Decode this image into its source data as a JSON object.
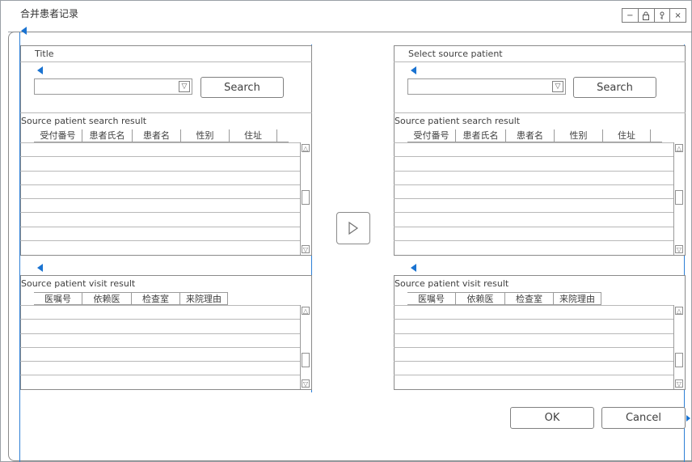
{
  "window": {
    "title": "合并患者记录",
    "controls": [
      {
        "name": "minimize",
        "glyph": "−"
      },
      {
        "name": "lock",
        "glyph": "🔒"
      },
      {
        "name": "pin",
        "glyph": "⚲"
      },
      {
        "name": "close",
        "glyph": "×"
      }
    ]
  },
  "left": {
    "title": "Title",
    "search_value": "",
    "search_label": "Search",
    "search_result_label": "Source patient search result",
    "search_columns": [
      "受付番号",
      "患者氏名",
      "患者名",
      "性别",
      "住址"
    ],
    "visit_result_label": "Source patient visit result",
    "visit_columns": [
      "医嘱号",
      "依赖医",
      "检查室",
      "来院理由"
    ]
  },
  "right": {
    "title": "Select source patient",
    "search_value": "",
    "search_label": "Search",
    "search_result_label": "Source patient search result",
    "search_columns": [
      "受付番号",
      "患者氏名",
      "患者名",
      "性别",
      "住址"
    ],
    "visit_result_label": "Source patient visit result",
    "visit_columns": [
      "医嘱号",
      "依赖医",
      "检查室",
      "来院理由"
    ]
  },
  "transfer_icon": "triangle-right",
  "footer": {
    "ok_label": "OK",
    "cancel_label": "Cancel"
  },
  "colors": {
    "guide": "#2d7fd6",
    "border": "#8a8a8a"
  }
}
